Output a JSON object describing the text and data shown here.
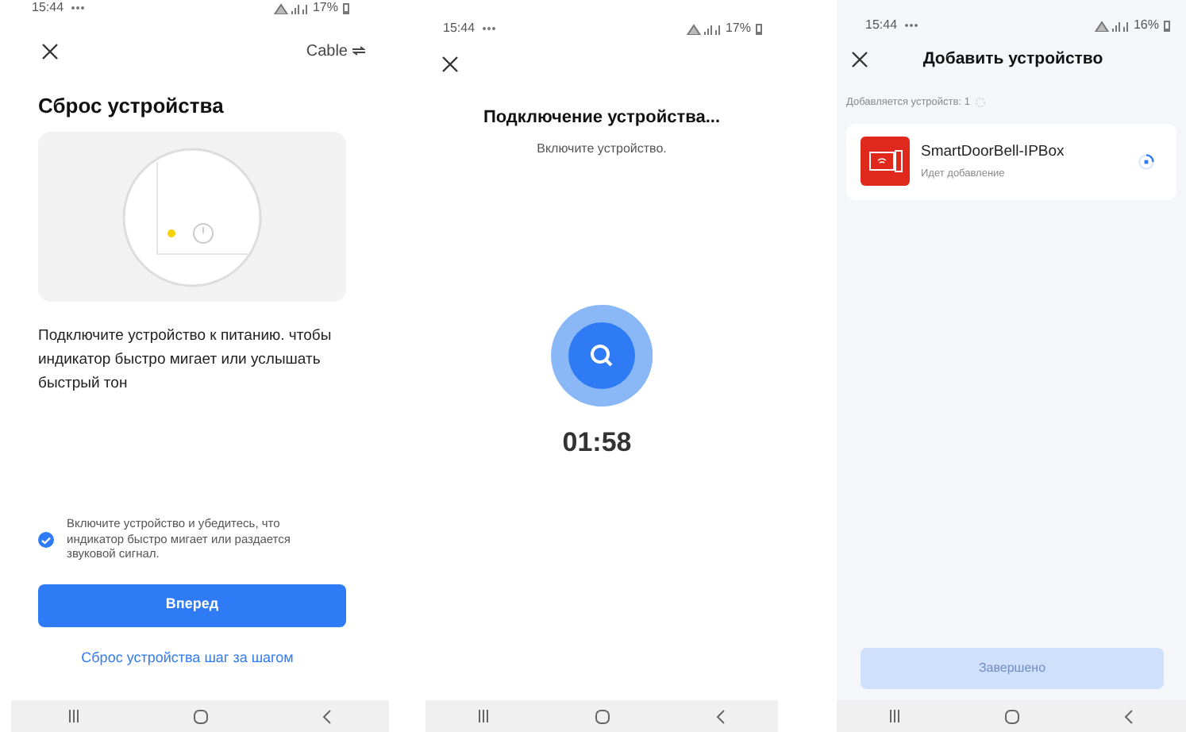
{
  "reset_screen": {
    "status_bar": {
      "time": "15:44",
      "battery": "17%"
    },
    "header_action": "Cable",
    "title": "Сброс устройства",
    "instruction": "Подключите устройство к питанию. чтобы индикатор быстро мигает или услышать быстрый тон",
    "confirm": {
      "label": "Включите устройство и убедитесь, что индикатор быстро мигает или раздается звуковой сигнал.",
      "checked": true
    },
    "primary_button": "Вперед",
    "link": "Сброс устройства шаг за шагом"
  },
  "connecting_screen": {
    "status_bar": {
      "time": "15:44",
      "battery": "17%"
    },
    "title": "Подключение устройства...",
    "subtitle": "Включите устройство.",
    "timer": "01:58"
  },
  "adding_screen": {
    "status_bar": {
      "time": "15:44",
      "battery": "16%"
    },
    "title": "Добавить устройство",
    "progress_label": "Добавляется устройств: 1",
    "devices": [
      {
        "name": "SmartDoorBell-IPBox",
        "status": "Идет добавление"
      }
    ],
    "finish_button": {
      "label": "Завершено",
      "disabled": true
    }
  }
}
